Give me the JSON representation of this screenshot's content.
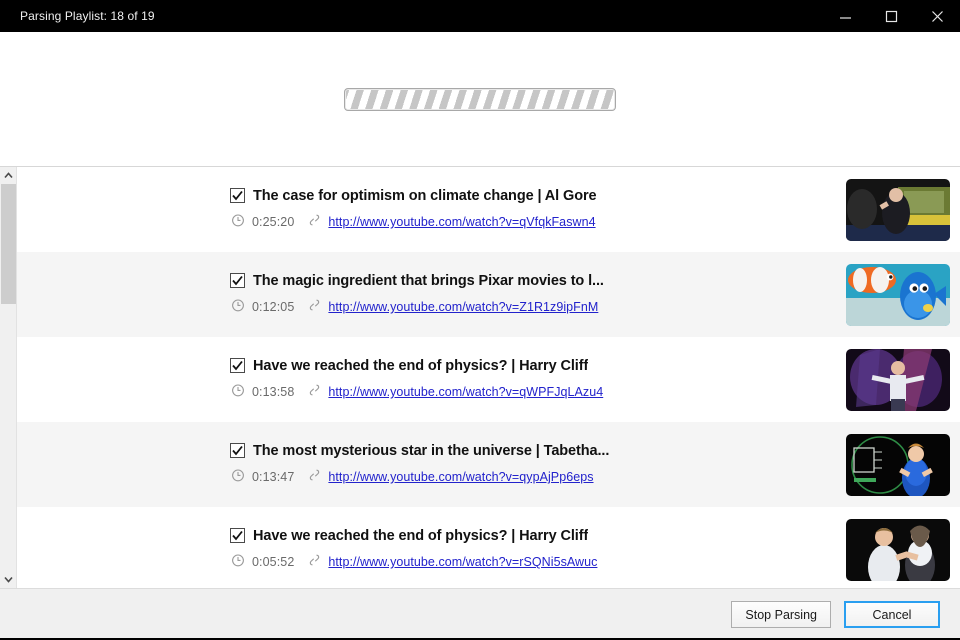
{
  "window": {
    "title": "Parsing Playlist: 18 of 19",
    "controls": {
      "minimize": "minimize-button",
      "maximize": "maximize-button",
      "close": "close-button"
    }
  },
  "progress": {
    "type": "indeterminate",
    "label": ""
  },
  "list": {
    "rows": [
      {
        "checked": true,
        "title": "The case for optimism on climate change | Al Gore",
        "duration": "0:25:20",
        "url": "http://www.youtube.com/watch?v=qVfqkFaswn4",
        "thumbnail": "al-gore-ted-stage"
      },
      {
        "checked": true,
        "title": "The magic ingredient that brings Pixar movies to l...",
        "duration": "0:12:05",
        "url": "http://www.youtube.com/watch?v=Z1R1z9ipFnM",
        "thumbnail": "pixar-finding-dory-fish"
      },
      {
        "checked": true,
        "title": "Have we reached the end of physics? | Harry Cliff",
        "duration": "0:13:58",
        "url": "http://www.youtube.com/watch?v=qWPFJqLAzu4",
        "thumbnail": "harry-cliff-purple-stage"
      },
      {
        "checked": true,
        "title": "The most mysterious star in the universe | Tabetha...",
        "duration": "0:13:47",
        "url": "http://www.youtube.com/watch?v=qypAjPp6eps",
        "thumbnail": "tabetha-boyajian-blue-dress"
      },
      {
        "checked": true,
        "title": "Have we reached the end of physics? | Harry Cliff",
        "duration": "0:05:52",
        "url": "http://www.youtube.com/watch?v=rSQNi5sAwuc",
        "thumbnail": "two-speakers-dark-stage"
      }
    ]
  },
  "scrollbar": {
    "up_arrow": "scroll-up-arrow",
    "down_arrow": "scroll-down-arrow",
    "thumb_position": "top"
  },
  "footer": {
    "stop_parsing_label": "Stop Parsing",
    "cancel_label": "Cancel",
    "focused_button": "Cancel"
  },
  "colors": {
    "titlebar_bg": "#000000",
    "link": "#2222cc",
    "focus_border": "#2a9ff0",
    "row_alt_bg": "#f5f5f5",
    "footer_bg": "#f0f0f0"
  }
}
